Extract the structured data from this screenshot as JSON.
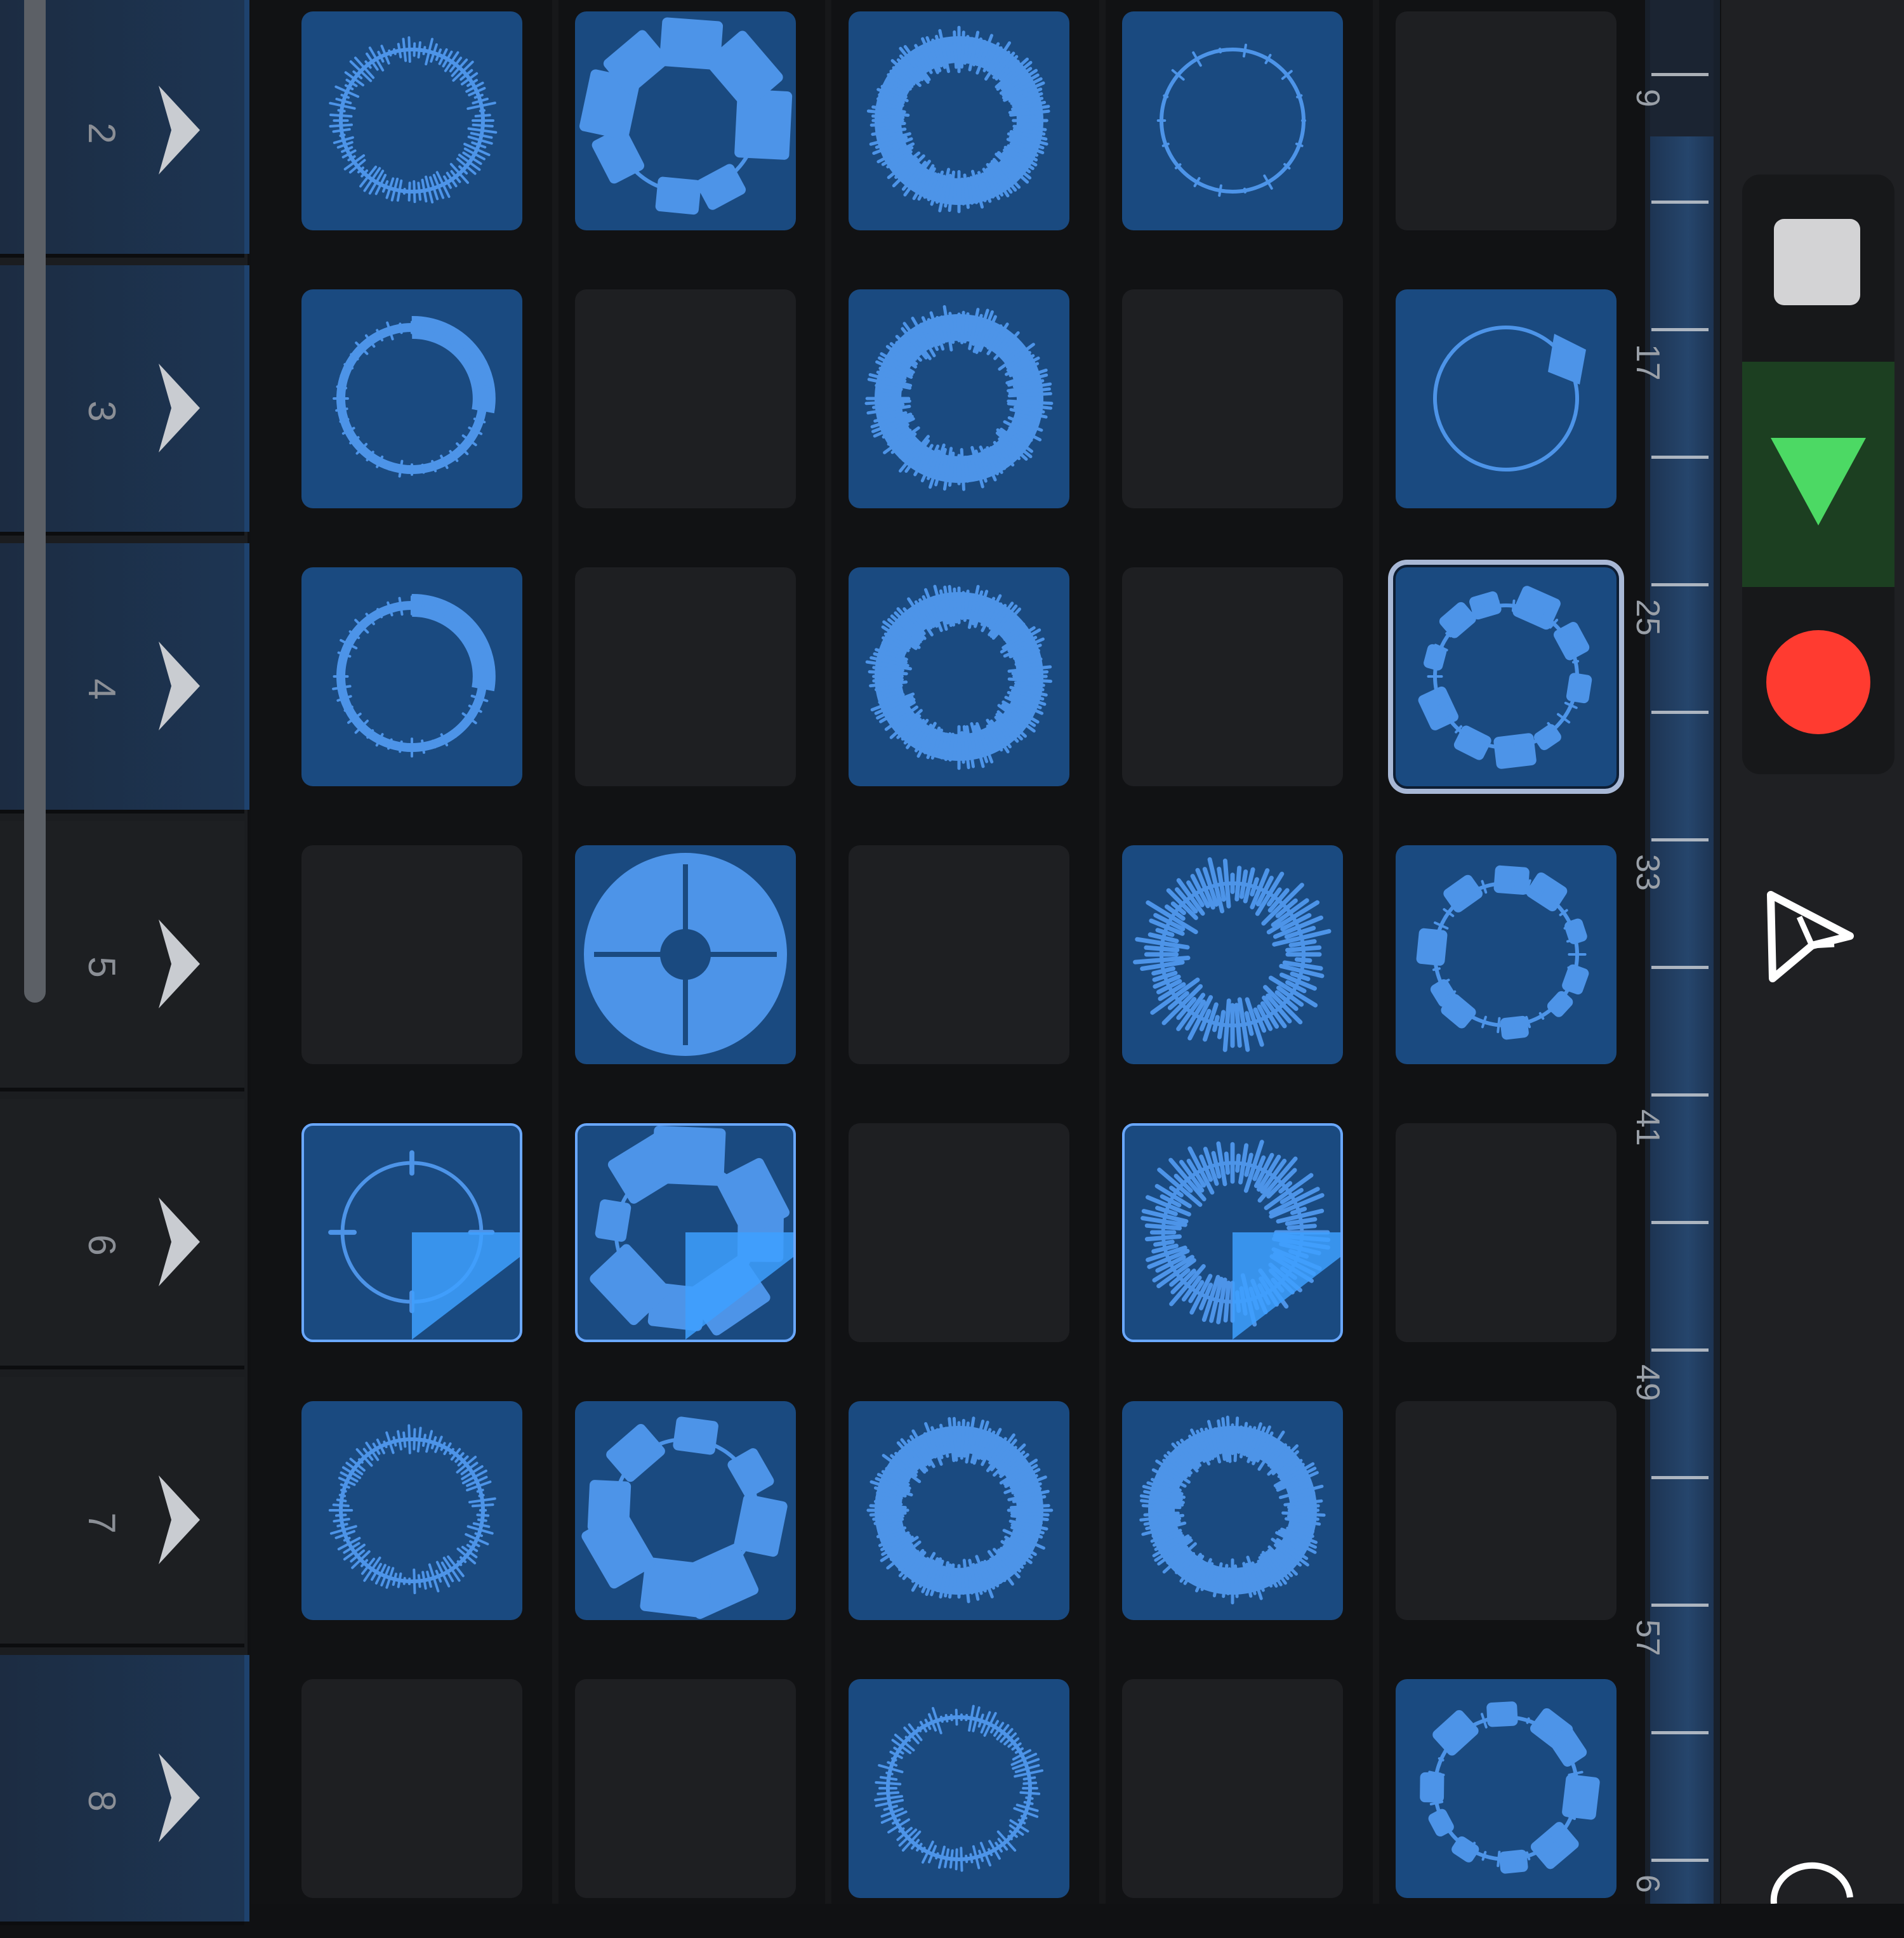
{
  "scenes": [
    {
      "label": "2",
      "highlight": true
    },
    {
      "label": "3",
      "highlight": true
    },
    {
      "label": "4",
      "highlight": true
    },
    {
      "label": "5",
      "highlight": false
    },
    {
      "label": "6",
      "highlight": false
    },
    {
      "label": "7",
      "highlight": false
    },
    {
      "label": "8",
      "highlight": true
    }
  ],
  "grid": [
    [
      "spikes",
      "blobs",
      "dense",
      "thin",
      "empty"
    ],
    [
      "arcs",
      "empty",
      "dense",
      "empty",
      "thin-burst"
    ],
    [
      "arcs",
      "empty",
      "dense",
      "empty",
      "blobs-small"
    ],
    [
      "empty",
      "quad",
      "empty",
      "jagged",
      "blobs-small"
    ],
    [
      "sparse",
      "blobs",
      "empty",
      "jagged",
      "empty"
    ],
    [
      "spikes",
      "blobs",
      "dense",
      "dense",
      "empty"
    ],
    [
      "empty",
      "empty",
      "spikes",
      "empty",
      "blobs-small"
    ]
  ],
  "cell_states": {
    "playing": [
      [
        4,
        0
      ],
      [
        4,
        1
      ],
      [
        4,
        3
      ]
    ],
    "selected": [
      [
        2,
        4
      ]
    ]
  },
  "playing_progress": 0.25,
  "timeline_marks": [
    "9",
    "17",
    "25",
    "33",
    "41",
    "49",
    "57",
    "6"
  ],
  "colors": {
    "loop_cell": "#1a4a80",
    "waveform": "#4d94e8",
    "playhead": "#3ea0ff",
    "play_button": "#4cd964",
    "record_button": "#ff3b30",
    "stop_button": "#d3d3d5"
  },
  "icons": {
    "stop": "square-stop-icon",
    "play": "triangle-play-icon",
    "record": "circle-record-icon",
    "pointer": "pointer-arrow-icon",
    "undo": "undo-arc-icon",
    "trigger": "chevron-right-icon"
  }
}
